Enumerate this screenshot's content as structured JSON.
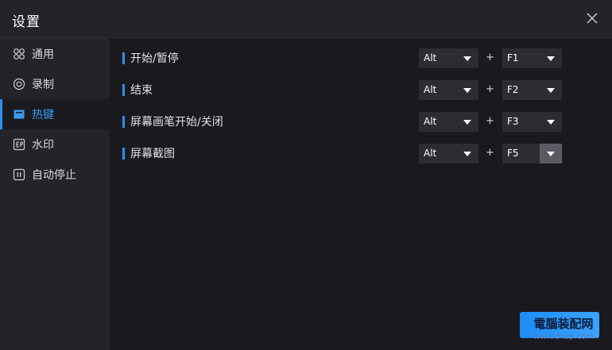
{
  "window": {
    "title": "设置",
    "close_icon": "close-icon"
  },
  "sidebar": {
    "items": [
      {
        "label": "通用",
        "icon": "grid-icon",
        "active": false
      },
      {
        "label": "录制",
        "icon": "record-icon",
        "active": false
      },
      {
        "label": "热键",
        "icon": "keyboard-icon",
        "active": true
      },
      {
        "label": "水印",
        "icon": "watermark-icon",
        "active": false
      },
      {
        "label": "自动停止",
        "icon": "pause-box-icon",
        "active": false
      }
    ]
  },
  "hotkeys": {
    "plus_sign": "+",
    "rows": [
      {
        "label": "开始/暂停",
        "modifier": "Alt",
        "key": "F1"
      },
      {
        "label": "结束",
        "modifier": "Alt",
        "key": "F2"
      },
      {
        "label": "屏幕画笔开始/关闭",
        "modifier": "Alt",
        "key": "F3"
      },
      {
        "label": "屏幕截图",
        "modifier": "Alt",
        "key": "F5"
      }
    ]
  },
  "watermark": {
    "main": "電腦装配网",
    "sub": "www.dnzp.com"
  },
  "colors": {
    "accent": "#2f8ff0",
    "background": "#19191e",
    "sidebar": "#23242a",
    "select_bg": "#2c2d33"
  }
}
